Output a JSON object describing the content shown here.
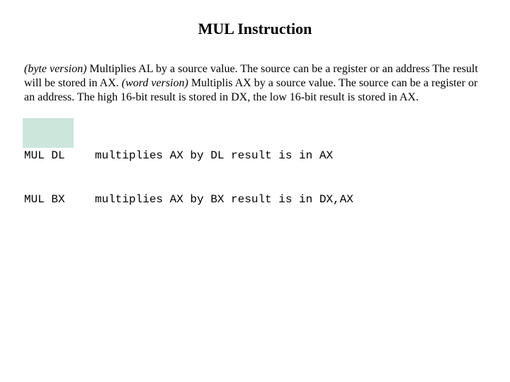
{
  "title": "MUL Instruction",
  "paragraph": {
    "byte_label": "(byte version)",
    "byte_text": " Multiplies AL by a source value.  The source can be a register or an address The result will be stored in AX. ",
    "word_label": "(word version)",
    "word_text": " Multiplis AX by a source value.  The source can be a register or an address.  The high 16-bit result is stored in DX, the low 16-bit result is stored in AX."
  },
  "code": [
    {
      "cmd": "MUL DL",
      "desc": "multiplies AX by DL result is in AX"
    },
    {
      "cmd": "MUL BX",
      "desc": "multiplies AX by BX result is in DX,AX"
    }
  ]
}
